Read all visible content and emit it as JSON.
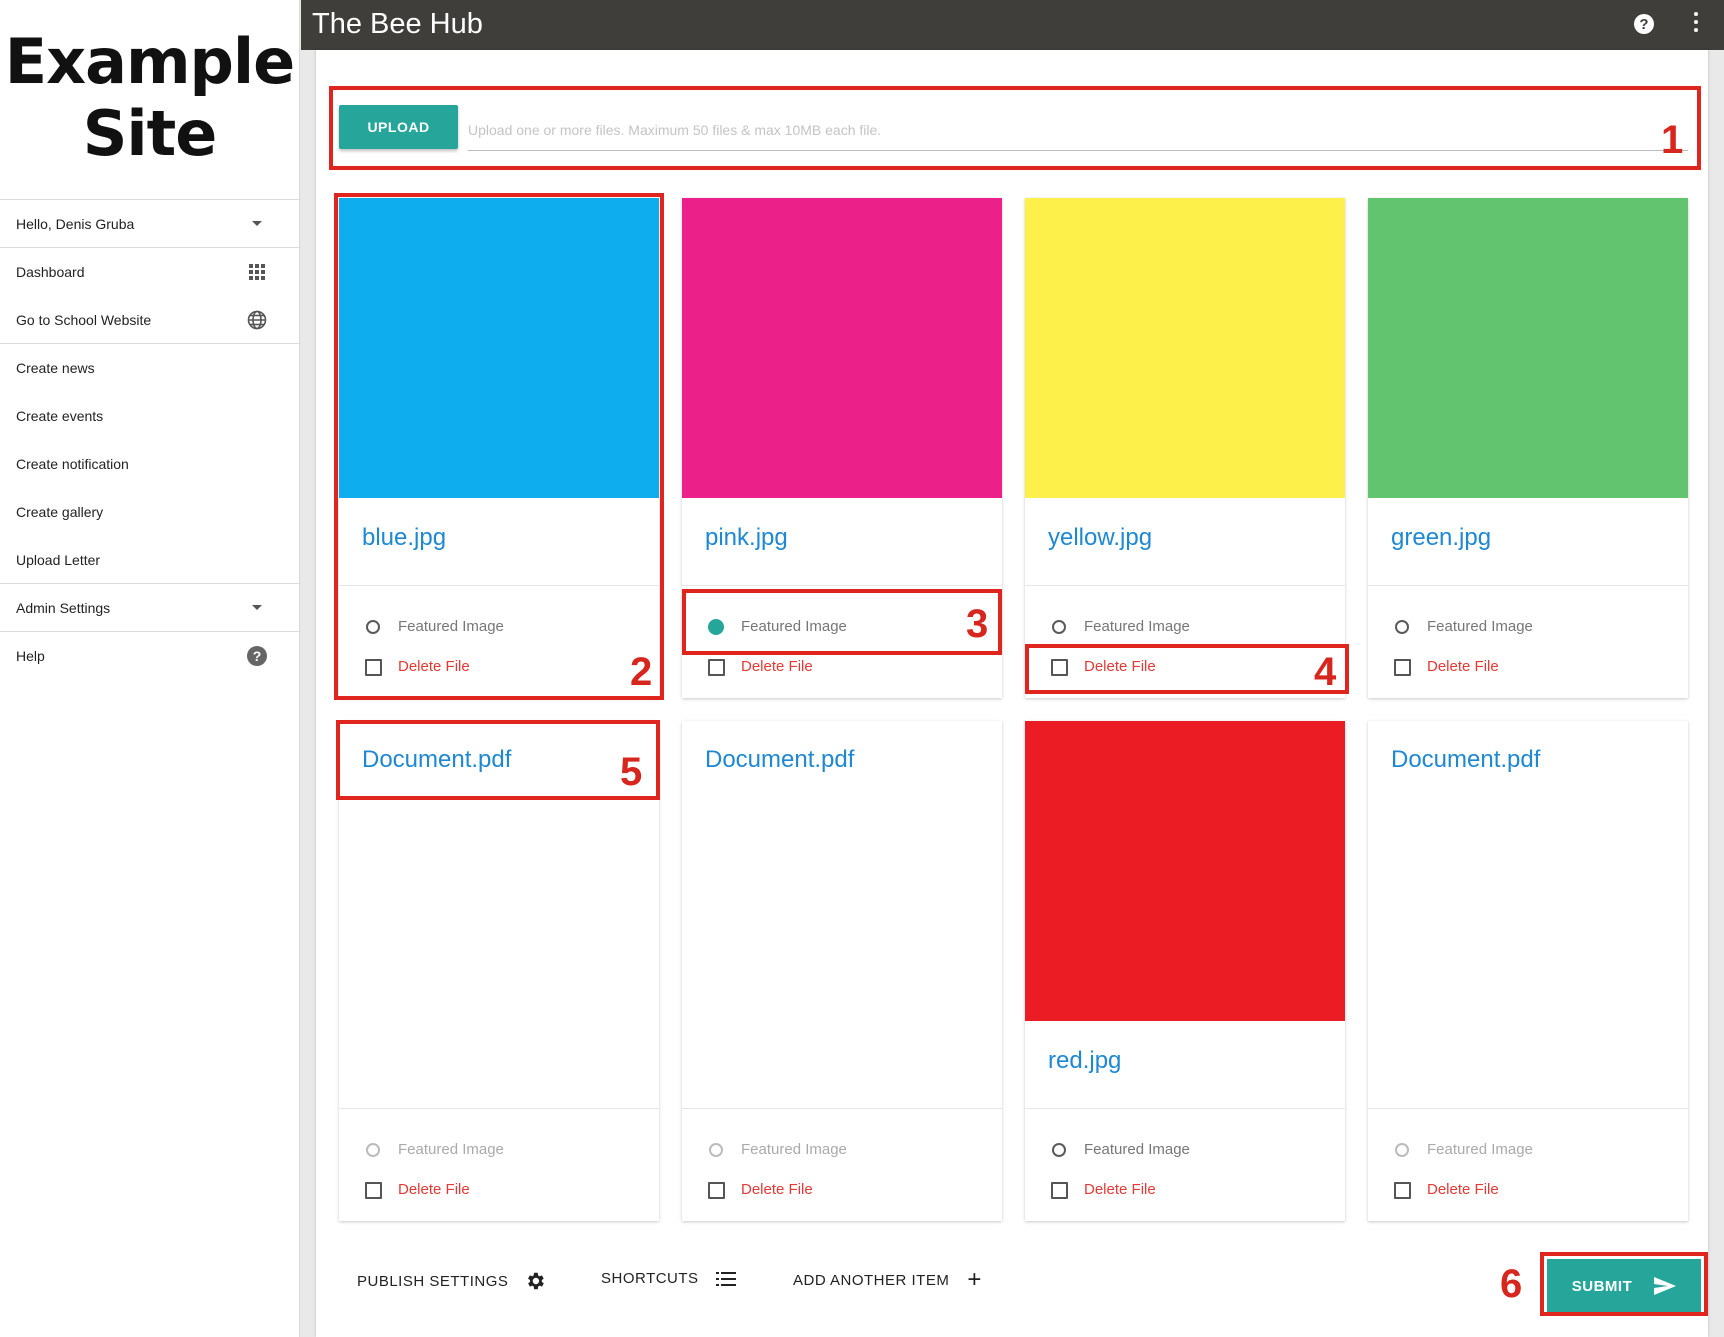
{
  "site": {
    "logo_line1": "Example",
    "logo_line2": "Site"
  },
  "sidebar": {
    "items": [
      {
        "label": "Hello, Denis Gruba",
        "icon": "caret-down-icon"
      },
      {
        "label": "Dashboard",
        "icon": "apps-grid-icon"
      },
      {
        "label": "Go to School Website",
        "icon": "globe-icon"
      },
      {
        "label": "Create news"
      },
      {
        "label": "Create events"
      },
      {
        "label": "Create notification"
      },
      {
        "label": "Create gallery"
      },
      {
        "label": "Upload Letter"
      },
      {
        "label": "Admin Settings",
        "icon": "caret-down-icon"
      },
      {
        "label": "Help",
        "icon": "help-circle-icon"
      }
    ]
  },
  "header": {
    "title": "The Bee Hub",
    "help_glyph": "?"
  },
  "upload": {
    "button_label": "UPLOAD",
    "placeholder": "Upload one or more files. Maximum 50 files & max 10MB each file."
  },
  "colors": {
    "accent": "#26a69a",
    "blue": "#0eaded",
    "pink": "#eb2189",
    "yellow": "#fdf04a",
    "green": "#62c46e",
    "red": "#ec1c24",
    "delete": "#e53935",
    "callout": "#e0251f"
  },
  "files": [
    {
      "name": "blue.jpg",
      "featured_label": "Featured Image",
      "delete_label": "Delete File",
      "featured": false
    },
    {
      "name": "pink.jpg",
      "featured_label": "Featured Image",
      "delete_label": "Delete File",
      "featured": true
    },
    {
      "name": "yellow.jpg",
      "featured_label": "Featured Image",
      "delete_label": "Delete File",
      "featured": false
    },
    {
      "name": "green.jpg",
      "featured_label": "Featured Image",
      "delete_label": "Delete File",
      "featured": false
    },
    {
      "name": "Document.pdf",
      "featured_label": "Featured Image",
      "delete_label": "Delete File",
      "featured": false
    },
    {
      "name": "Document.pdf",
      "featured_label": "Featured Image",
      "delete_label": "Delete File",
      "featured": false
    },
    {
      "name": "red.jpg",
      "featured_label": "Featured Image",
      "delete_label": "Delete File",
      "featured": false
    },
    {
      "name": "Document.pdf",
      "featured_label": "Featured Image",
      "delete_label": "Delete File",
      "featured": false
    }
  ],
  "callouts": [
    "1",
    "2",
    "3",
    "4",
    "5",
    "6"
  ],
  "footer": {
    "publish_settings": "PUBLISH SETTINGS",
    "shortcuts": "SHORTCUTS",
    "add_item": "ADD ANOTHER ITEM",
    "add_glyph": "+",
    "submit": "SUBMIT"
  }
}
